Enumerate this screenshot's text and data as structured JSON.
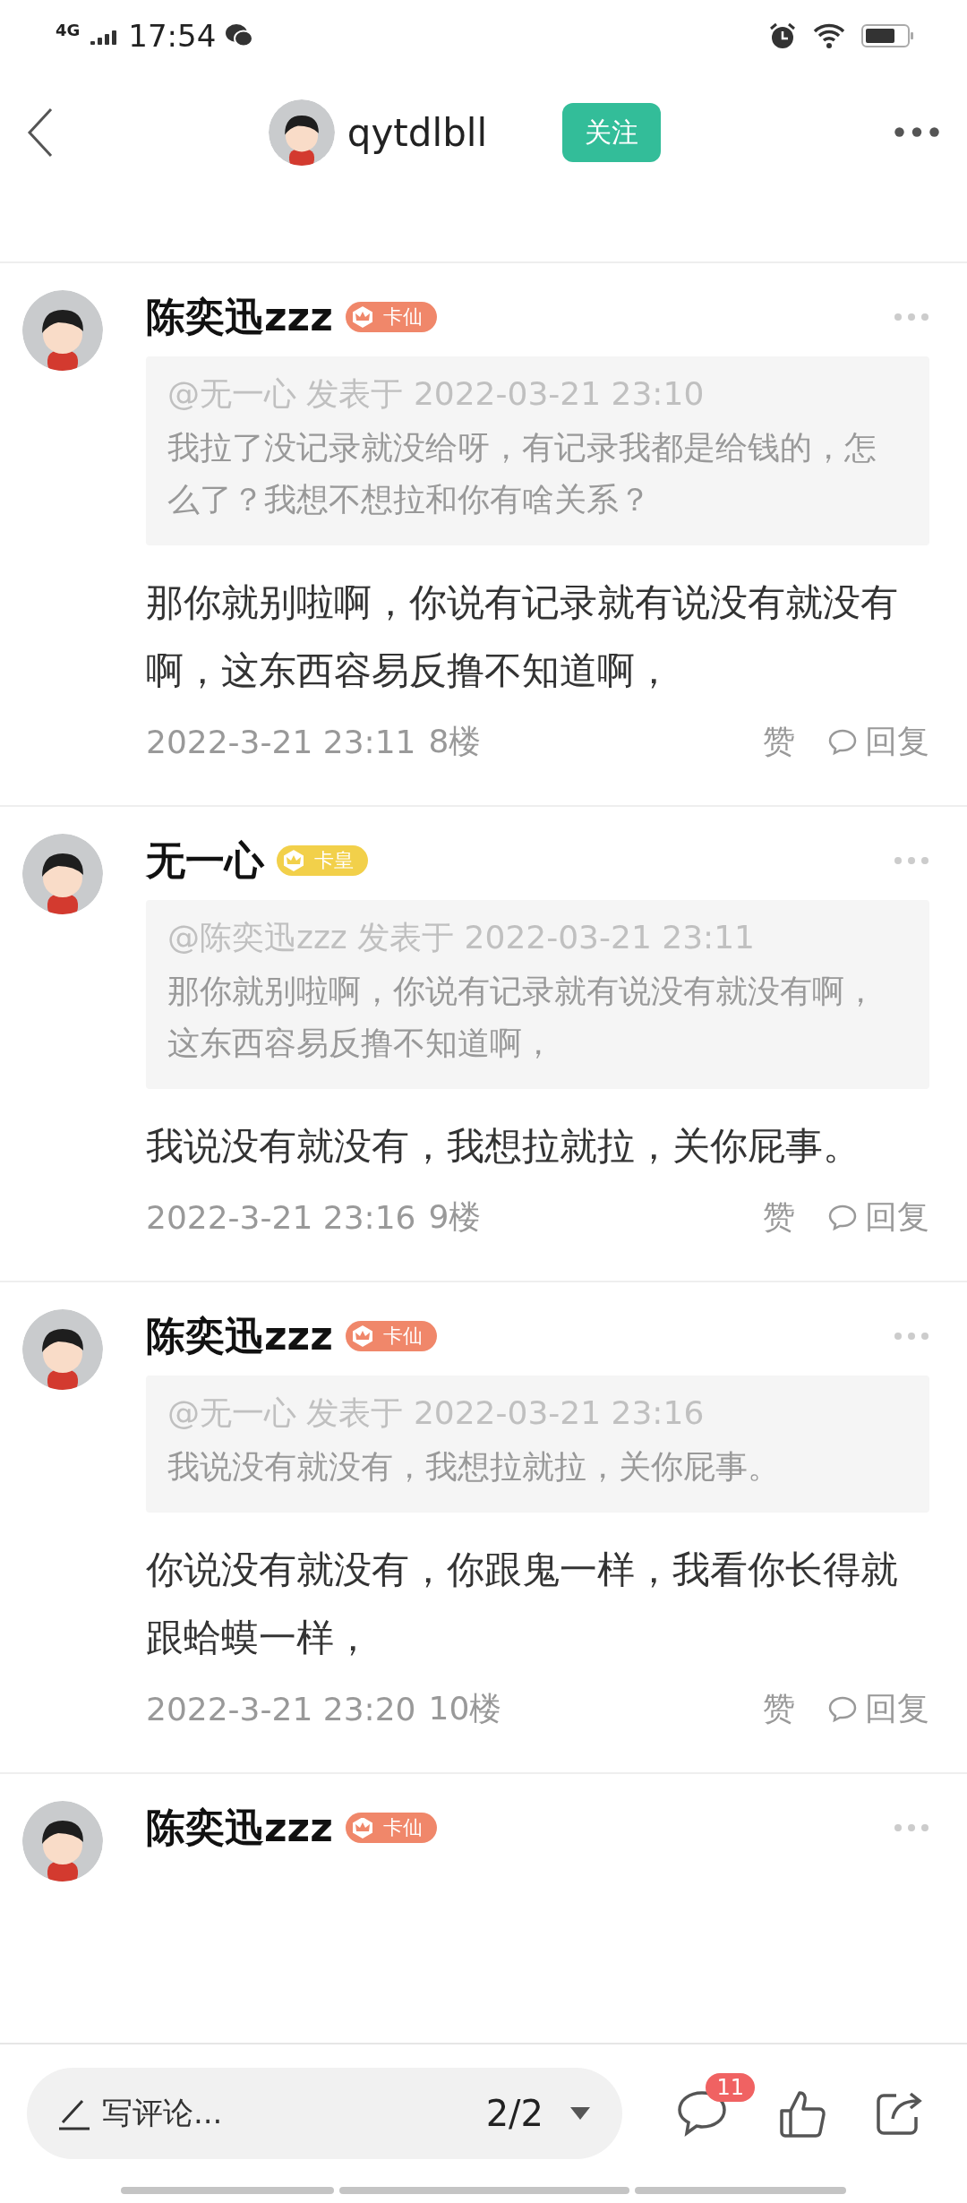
{
  "status_bar": {
    "network": "4G",
    "time": "17:54"
  },
  "header": {
    "username": "qytdlbll",
    "follow_button": "关注"
  },
  "comments": [
    {
      "author": "陈奕迅zzz",
      "badge": {
        "label": "卡仙",
        "color": "#f0876a"
      },
      "quote": {
        "header": "@无一心 发表于 2022-03-21 23:10",
        "text": "我拉了没记录就没给呀，有记录我都是给钱的，怎么了？我想不想拉和你有啥关系？"
      },
      "text": "那你就别啦啊，你说有记录就有说没有就没有啊，这东西容易反撸不知道啊，",
      "time": "2022-3-21 23:11",
      "floor": "8楼",
      "like": "赞",
      "reply": "回复"
    },
    {
      "author": "无一心",
      "badge": {
        "label": "卡皇",
        "color": "#f2d04a"
      },
      "quote": {
        "header": "@陈奕迅zzz 发表于 2022-03-21 23:11",
        "text": "那你就别啦啊，你说有记录就有说没有就没有啊，这东西容易反撸不知道啊，"
      },
      "text": "我说没有就没有，我想拉就拉，关你屁事。",
      "time": "2022-3-21 23:16",
      "floor": "9楼",
      "like": "赞",
      "reply": "回复"
    },
    {
      "author": "陈奕迅zzz",
      "badge": {
        "label": "卡仙",
        "color": "#f0876a"
      },
      "quote": {
        "header": "@无一心 发表于 2022-03-21 23:16",
        "text": "我说没有就没有，我想拉就拉，关你屁事。"
      },
      "text": "你说没有就没有，你跟鬼一样，我看你长得就跟蛤蟆一样，",
      "time": "2022-3-21 23:20",
      "floor": "10楼",
      "like": "赞",
      "reply": "回复"
    },
    {
      "author": "陈奕迅zzz",
      "badge": {
        "label": "卡仙",
        "color": "#f0876a"
      }
    }
  ],
  "bottom_bar": {
    "placeholder": "写评论...",
    "page": "2/2",
    "comment_count": "11"
  }
}
